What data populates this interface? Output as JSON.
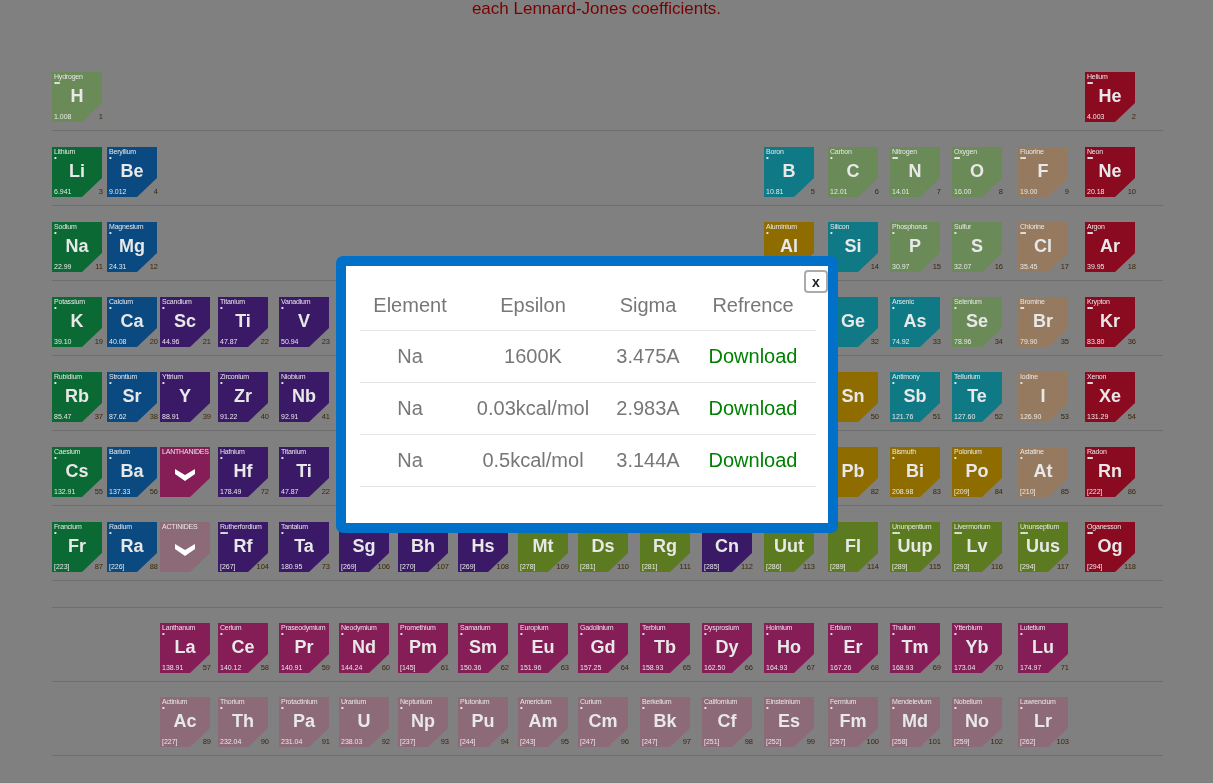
{
  "heading": "each Lennard-Jones coefficients.",
  "periodic_table": {
    "rows": [
      [
        {
          "kind": "element",
          "name": "Hydrogen",
          "dots": "•••",
          "symbol": "H",
          "mass": "1.008",
          "number": "1",
          "color": "#6a8a58"
        },
        {
          "kind": "empty"
        },
        {
          "kind": "empty"
        },
        {
          "kind": "empty"
        },
        {
          "kind": "empty"
        },
        {
          "kind": "empty"
        },
        {
          "kind": "empty"
        },
        {
          "kind": "empty"
        },
        {
          "kind": "empty"
        },
        {
          "kind": "empty"
        },
        {
          "kind": "empty"
        },
        {
          "kind": "empty"
        },
        {
          "kind": "empty"
        },
        {
          "kind": "empty"
        },
        {
          "kind": "empty"
        },
        {
          "kind": "empty"
        },
        {
          "kind": "empty"
        },
        {
          "kind": "element",
          "name": "Helium",
          "dots": "•••",
          "symbol": "He",
          "mass": "4.003",
          "number": "2",
          "color": "#8a0a20"
        }
      ],
      [
        {
          "kind": "element",
          "name": "Lithium",
          "dots": "•",
          "symbol": "Li",
          "mass": "6.941",
          "number": "3",
          "color": "#0b6a34"
        },
        {
          "kind": "element",
          "name": "Beryllium",
          "dots": "•",
          "symbol": "Be",
          "mass": "9.012",
          "number": "4",
          "color": "#0a4a80"
        },
        {
          "kind": "empty"
        },
        {
          "kind": "empty"
        },
        {
          "kind": "empty"
        },
        {
          "kind": "empty"
        },
        {
          "kind": "empty"
        },
        {
          "kind": "empty"
        },
        {
          "kind": "empty"
        },
        {
          "kind": "empty"
        },
        {
          "kind": "empty"
        },
        {
          "kind": "empty"
        },
        {
          "kind": "element",
          "name": "Boron",
          "dots": "•",
          "symbol": "B",
          "mass": "10.81",
          "number": "5",
          "color": "#0f7a85"
        },
        {
          "kind": "element",
          "name": "Carbon",
          "dots": "•",
          "symbol": "C",
          "mass": "12.01",
          "number": "6",
          "color": "#6a8a58"
        },
        {
          "kind": "element",
          "name": "Nitrogen",
          "dots": "•••",
          "symbol": "N",
          "mass": "14.01",
          "number": "7",
          "color": "#6a8a58"
        },
        {
          "kind": "element",
          "name": "Oxygen",
          "dots": "•••",
          "symbol": "O",
          "mass": "16.00",
          "number": "8",
          "color": "#6a8a58"
        },
        {
          "kind": "element",
          "name": "Fluorine",
          "dots": "•••",
          "symbol": "F",
          "mass": "19.00",
          "number": "9",
          "color": "#957a60"
        },
        {
          "kind": "element",
          "name": "Neon",
          "dots": "•••",
          "symbol": "Ne",
          "mass": "20.18",
          "number": "10",
          "color": "#8a0a20"
        }
      ],
      [
        {
          "kind": "element",
          "name": "Sodium",
          "dots": "•",
          "symbol": "Na",
          "mass": "22.99",
          "number": "11",
          "color": "#0b6a34"
        },
        {
          "kind": "element",
          "name": "Magnesium",
          "dots": "•",
          "symbol": "Mg",
          "mass": "24.31",
          "number": "12",
          "color": "#0a4a80"
        },
        {
          "kind": "empty"
        },
        {
          "kind": "empty"
        },
        {
          "kind": "empty"
        },
        {
          "kind": "empty"
        },
        {
          "kind": "empty"
        },
        {
          "kind": "empty"
        },
        {
          "kind": "empty"
        },
        {
          "kind": "empty"
        },
        {
          "kind": "empty"
        },
        {
          "kind": "empty"
        },
        {
          "kind": "element",
          "name": "Aluminium",
          "dots": "•",
          "symbol": "Al",
          "color": "#8f6c00"
        },
        {
          "kind": "element",
          "name": "Silicon",
          "dots": "•",
          "symbol": "Si",
          "number": "14",
          "color": "#0f7a85"
        },
        {
          "kind": "element",
          "name": "Phosphorus",
          "dots": "•",
          "symbol": "P",
          "mass": "30.97",
          "number": "15",
          "color": "#6a8a58"
        },
        {
          "kind": "element",
          "name": "Sulfur",
          "dots": "•",
          "symbol": "S",
          "mass": "32.07",
          "number": "16",
          "color": "#6a8a58"
        },
        {
          "kind": "element",
          "name": "Chlorine",
          "dots": "•••",
          "symbol": "Cl",
          "mass": "35.45",
          "number": "17",
          "color": "#957a60"
        },
        {
          "kind": "element",
          "name": "Argon",
          "dots": "•••",
          "symbol": "Ar",
          "mass": "39.95",
          "number": "18",
          "color": "#8a0a20"
        }
      ],
      [
        {
          "kind": "element",
          "name": "Potassium",
          "dots": "•",
          "symbol": "K",
          "mass": "39.10",
          "number": "19",
          "color": "#0b6a34"
        },
        {
          "kind": "element",
          "name": "Calcium",
          "dots": "•",
          "symbol": "Ca",
          "mass": "40.08",
          "number": "20",
          "color": "#0a4a80"
        },
        {
          "kind": "element",
          "name": "Scandium",
          "dots": "•",
          "symbol": "Sc",
          "mass": "44.96",
          "number": "21",
          "color": "#3a1a66"
        },
        {
          "kind": "element",
          "name": "Titanium",
          "dots": "•",
          "symbol": "Ti",
          "mass": "47.87",
          "number": "22",
          "color": "#3a1a66"
        },
        {
          "kind": "element",
          "name": "Vanadium",
          "dots": "•",
          "symbol": "V",
          "mass": "50.94",
          "number": "23",
          "color": "#3a1a66"
        },
        {
          "kind": "empty"
        },
        {
          "kind": "empty"
        },
        {
          "kind": "empty"
        },
        {
          "kind": "empty"
        },
        {
          "kind": "empty"
        },
        {
          "kind": "empty"
        },
        {
          "kind": "empty"
        },
        {
          "kind": "empty"
        },
        {
          "kind": "element",
          "symbol": "Ge",
          "number": "32",
          "color": "#0f7a85"
        },
        {
          "kind": "element",
          "name": "Arsenic",
          "dots": "•",
          "symbol": "As",
          "mass": "74.92",
          "number": "33",
          "color": "#0f7a85"
        },
        {
          "kind": "element",
          "name": "Selenium",
          "dots": "•",
          "symbol": "Se",
          "mass": "78.96",
          "number": "34",
          "color": "#6a8a58"
        },
        {
          "kind": "element",
          "name": "Bromine",
          "dots": "••",
          "symbol": "Br",
          "mass": "79.90",
          "number": "35",
          "color": "#957a60"
        },
        {
          "kind": "element",
          "name": "Krypton",
          "dots": "•••",
          "symbol": "Kr",
          "mass": "83.80",
          "number": "36",
          "color": "#8a0a20"
        }
      ],
      [
        {
          "kind": "element",
          "name": "Rubidium",
          "dots": "•",
          "symbol": "Rb",
          "mass": "85.47",
          "number": "37",
          "color": "#0b6a34"
        },
        {
          "kind": "element",
          "name": "Strontium",
          "dots": "•",
          "symbol": "Sr",
          "mass": "87.62",
          "number": "38",
          "color": "#0a4a80"
        },
        {
          "kind": "element",
          "name": "Yttrium",
          "dots": "•",
          "symbol": "Y",
          "mass": "88.91",
          "number": "39",
          "color": "#3a1a66"
        },
        {
          "kind": "element",
          "name": "Zirconium",
          "dots": "•",
          "symbol": "Zr",
          "mass": "91.22",
          "number": "40",
          "color": "#3a1a66"
        },
        {
          "kind": "element",
          "name": "Niobium",
          "dots": "•",
          "symbol": "Nb",
          "mass": "92.91",
          "number": "41",
          "color": "#3a1a66"
        },
        {
          "kind": "empty"
        },
        {
          "kind": "empty"
        },
        {
          "kind": "empty"
        },
        {
          "kind": "empty"
        },
        {
          "kind": "empty"
        },
        {
          "kind": "empty"
        },
        {
          "kind": "empty"
        },
        {
          "kind": "empty"
        },
        {
          "kind": "element",
          "symbol": "Sn",
          "number": "50",
          "color": "#8f6c00"
        },
        {
          "kind": "element",
          "name": "Antimony",
          "dots": "•",
          "symbol": "Sb",
          "mass": "121.76",
          "number": "51",
          "color": "#0f7a85"
        },
        {
          "kind": "element",
          "name": "Tellurium",
          "dots": "•",
          "symbol": "Te",
          "mass": "127.60",
          "number": "52",
          "color": "#0f7a85"
        },
        {
          "kind": "element",
          "name": "Iodine",
          "dots": "•",
          "symbol": "I",
          "mass": "126.90",
          "number": "53",
          "color": "#957a60"
        },
        {
          "kind": "element",
          "name": "Xenon",
          "dots": "•••",
          "symbol": "Xe",
          "mass": "131.29",
          "number": "54",
          "color": "#8a0a20"
        }
      ],
      [
        {
          "kind": "element",
          "name": "Caesium",
          "dots": "•",
          "symbol": "Cs",
          "mass": "132.91",
          "number": "55",
          "color": "#0b6a34"
        },
        {
          "kind": "element",
          "name": "Barium",
          "dots": "•",
          "symbol": "Ba",
          "mass": "137.33",
          "number": "56",
          "color": "#0a4a80"
        },
        {
          "kind": "series",
          "label": "LANTHANIDES",
          "color": "#851d57"
        },
        {
          "kind": "element",
          "name": "Hafnium",
          "dots": "•",
          "symbol": "Hf",
          "mass": "178.49",
          "number": "72",
          "color": "#3a1a66"
        },
        {
          "kind": "element",
          "name": "Titanium",
          "dots": "•",
          "symbol": "Ti",
          "mass": "47.87",
          "number": "22",
          "color": "#3a1a66"
        },
        {
          "kind": "empty"
        },
        {
          "kind": "empty"
        },
        {
          "kind": "empty"
        },
        {
          "kind": "empty"
        },
        {
          "kind": "empty"
        },
        {
          "kind": "empty"
        },
        {
          "kind": "empty"
        },
        {
          "kind": "empty"
        },
        {
          "kind": "element",
          "symbol": "Pb",
          "number": "82",
          "color": "#8f6c00"
        },
        {
          "kind": "element",
          "name": "Bismuth",
          "dots": "•",
          "symbol": "Bi",
          "mass": "208.98",
          "number": "83",
          "color": "#8f6c00"
        },
        {
          "kind": "element",
          "name": "Polonium",
          "dots": "•",
          "symbol": "Po",
          "mass": "[209]",
          "number": "84",
          "color": "#8f6c00"
        },
        {
          "kind": "element",
          "name": "Astatine",
          "dots": "•",
          "symbol": "At",
          "mass": "[210]",
          "number": "85",
          "color": "#957a60"
        },
        {
          "kind": "element",
          "name": "Radon",
          "dots": "•••",
          "symbol": "Rn",
          "mass": "[222]",
          "number": "86",
          "color": "#8a0a20"
        }
      ],
      [
        {
          "kind": "element",
          "name": "Francium",
          "dots": "•",
          "symbol": "Fr",
          "mass": "[223]",
          "number": "87",
          "color": "#0b6a34"
        },
        {
          "kind": "element",
          "name": "Radium",
          "dots": "•",
          "symbol": "Ra",
          "mass": "[226]",
          "number": "88",
          "color": "#0a4a80"
        },
        {
          "kind": "series",
          "label": "ACTINIDES",
          "color": "#8c6a78"
        },
        {
          "kind": "element",
          "name": "Rutherfordium",
          "dots": "••••",
          "symbol": "Rf",
          "mass": "[267]",
          "number": "104",
          "color": "#3a1a66"
        },
        {
          "kind": "element",
          "name": "Tantalum",
          "dots": "•",
          "symbol": "Ta",
          "mass": "180.95",
          "number": "73",
          "color": "#3a1a66"
        },
        {
          "kind": "element",
          "symbol": "Sg",
          "mass": "[269]",
          "number": "106",
          "color": "#3a1a66"
        },
        {
          "kind": "element",
          "symbol": "Bh",
          "mass": "[270]",
          "number": "107",
          "color": "#3a1a66"
        },
        {
          "kind": "element",
          "symbol": "Hs",
          "mass": "[269]",
          "number": "108",
          "color": "#3a1a66"
        },
        {
          "kind": "element",
          "symbol": "Mt",
          "mass": "[278]",
          "number": "109",
          "color": "#5c7a20"
        },
        {
          "kind": "element",
          "symbol": "Ds",
          "mass": "[281]",
          "number": "110",
          "color": "#5c7a20"
        },
        {
          "kind": "element",
          "symbol": "Rg",
          "mass": "[281]",
          "number": "111",
          "color": "#5c7a20"
        },
        {
          "kind": "element",
          "symbol": "Cn",
          "mass": "[285]",
          "number": "112",
          "color": "#3a1a66"
        },
        {
          "kind": "element",
          "symbol": "Uut",
          "mass": "[286]",
          "number": "113",
          "color": "#5c7a20"
        },
        {
          "kind": "element",
          "symbol": "Fl",
          "mass": "[289]",
          "number": "114",
          "color": "#5c7a20"
        },
        {
          "kind": "element",
          "name": "Ununpentium",
          "dots": "••••",
          "symbol": "Uup",
          "mass": "[289]",
          "number": "115",
          "color": "#5c7a20"
        },
        {
          "kind": "element",
          "name": "Livermorium",
          "dots": "••••",
          "symbol": "Lv",
          "mass": "[293]",
          "number": "116",
          "color": "#5c7a20"
        },
        {
          "kind": "element",
          "name": "Ununseptium",
          "dots": "••••",
          "symbol": "Uus",
          "mass": "[294]",
          "number": "117",
          "color": "#5c7a20"
        },
        {
          "kind": "element",
          "name": "Oganesson",
          "dots": "•••",
          "symbol": "Og",
          "mass": "[294]",
          "number": "118",
          "color": "#8a0a20"
        }
      ]
    ],
    "series_rows": [
      [
        {
          "kind": "empty"
        },
        {
          "kind": "empty"
        },
        {
          "kind": "element",
          "name": "Lanthanum",
          "dots": "•",
          "symbol": "La",
          "mass": "138.91",
          "number": "57",
          "color": "#851d57"
        },
        {
          "kind": "element",
          "name": "Cerium",
          "dots": "•",
          "symbol": "Ce",
          "mass": "140.12",
          "number": "58",
          "color": "#851d57"
        },
        {
          "kind": "element",
          "name": "Praseodymium",
          "dots": "•",
          "symbol": "Pr",
          "mass": "140.91",
          "number": "59",
          "color": "#851d57"
        },
        {
          "kind": "element",
          "name": "Neodymium",
          "dots": "•",
          "symbol": "Nd",
          "mass": "144.24",
          "number": "60",
          "color": "#851d57"
        },
        {
          "kind": "element",
          "name": "Promethium",
          "dots": "•",
          "symbol": "Pm",
          "mass": "[145]",
          "number": "61",
          "color": "#851d57"
        },
        {
          "kind": "element",
          "name": "Samarium",
          "dots": "•",
          "symbol": "Sm",
          "mass": "150.36",
          "number": "62",
          "color": "#851d57"
        },
        {
          "kind": "element",
          "name": "Europium",
          "dots": "•",
          "symbol": "Eu",
          "mass": "151.96",
          "number": "63",
          "color": "#851d57"
        },
        {
          "kind": "element",
          "name": "Gadolinium",
          "dots": "•",
          "symbol": "Gd",
          "mass": "157.25",
          "number": "64",
          "color": "#851d57"
        },
        {
          "kind": "element",
          "name": "Terbium",
          "dots": "•",
          "symbol": "Tb",
          "mass": "158.93",
          "number": "65",
          "color": "#851d57"
        },
        {
          "kind": "element",
          "name": "Dysprosium",
          "dots": "•",
          "symbol": "Dy",
          "mass": "162.50",
          "number": "66",
          "color": "#851d57"
        },
        {
          "kind": "element",
          "name": "Holmium",
          "dots": "•",
          "symbol": "Ho",
          "mass": "164.93",
          "number": "67",
          "color": "#851d57"
        },
        {
          "kind": "element",
          "name": "Erbium",
          "dots": "•",
          "symbol": "Er",
          "mass": "167.26",
          "number": "68",
          "color": "#851d57"
        },
        {
          "kind": "element",
          "name": "Thulium",
          "dots": "•",
          "symbol": "Tm",
          "mass": "168.93",
          "number": "69",
          "color": "#851d57"
        },
        {
          "kind": "element",
          "name": "Ytterbium",
          "dots": "•",
          "symbol": "Yb",
          "mass": "173.04",
          "number": "70",
          "color": "#851d57"
        },
        {
          "kind": "element",
          "name": "Lutetium",
          "dots": "•",
          "symbol": "Lu",
          "mass": "174.97",
          "number": "71",
          "color": "#851d57"
        }
      ],
      [
        {
          "kind": "empty"
        },
        {
          "kind": "empty"
        },
        {
          "kind": "element",
          "name": "Actinium",
          "dots": "•",
          "symbol": "Ac",
          "mass": "[227]",
          "number": "89",
          "color": "#8c6a78"
        },
        {
          "kind": "element",
          "name": "Thorium",
          "dots": "•",
          "symbol": "Th",
          "mass": "232.04",
          "number": "90",
          "color": "#8c6a78"
        },
        {
          "kind": "element",
          "name": "Protactinium",
          "dots": "•",
          "symbol": "Pa",
          "mass": "231.04",
          "number": "91",
          "color": "#8c6a78"
        },
        {
          "kind": "element",
          "name": "Uranium",
          "dots": "•",
          "symbol": "U",
          "mass": "238.03",
          "number": "92",
          "color": "#8c6a78"
        },
        {
          "kind": "element",
          "name": "Neptunium",
          "dots": "•",
          "symbol": "Np",
          "mass": "[237]",
          "number": "93",
          "color": "#8c6a78"
        },
        {
          "kind": "element",
          "name": "Plutonium",
          "dots": "•",
          "symbol": "Pu",
          "mass": "[244]",
          "number": "94",
          "color": "#8c6a78"
        },
        {
          "kind": "element",
          "name": "Americium",
          "dots": "•",
          "symbol": "Am",
          "mass": "[243]",
          "number": "95",
          "color": "#8c6a78"
        },
        {
          "kind": "element",
          "name": "Curium",
          "dots": "•",
          "symbol": "Cm",
          "mass": "[247]",
          "number": "96",
          "color": "#8c6a78"
        },
        {
          "kind": "element",
          "name": "Berkelium",
          "dots": "•",
          "symbol": "Bk",
          "mass": "[247]",
          "number": "97",
          "color": "#8c6a78"
        },
        {
          "kind": "element",
          "name": "Californium",
          "dots": "•",
          "symbol": "Cf",
          "mass": "[251]",
          "number": "98",
          "color": "#8c6a78"
        },
        {
          "kind": "element",
          "name": "Einsteinium",
          "dots": "•",
          "symbol": "Es",
          "mass": "[252]",
          "number": "99",
          "color": "#8c6a78"
        },
        {
          "kind": "element",
          "name": "Fermium",
          "dots": "•",
          "symbol": "Fm",
          "mass": "[257]",
          "number": "100",
          "color": "#8c6a78"
        },
        {
          "kind": "element",
          "name": "Mendelevium",
          "dots": "•",
          "symbol": "Md",
          "mass": "[258]",
          "number": "101",
          "color": "#8c6a78"
        },
        {
          "kind": "element",
          "name": "Nobelium",
          "dots": "•",
          "symbol": "No",
          "mass": "[259]",
          "number": "102",
          "color": "#8c6a78"
        },
        {
          "kind": "element",
          "name": "Lawrencium",
          "dots": "•",
          "symbol": "Lr",
          "mass": "[262]",
          "number": "103",
          "color": "#8c6a78"
        }
      ]
    ]
  },
  "dialog": {
    "close": "x",
    "columns": [
      "Element",
      "Epsilon",
      "Sigma",
      "Refrence"
    ],
    "rows": [
      {
        "element": "Na",
        "epsilon": "1600K",
        "sigma": "3.475A",
        "reference": "Download"
      },
      {
        "element": "Na",
        "epsilon": "0.03kcal/mol",
        "sigma": "2.983A",
        "reference": "Download"
      },
      {
        "element": "Na",
        "epsilon": "0.5kcal/mol",
        "sigma": "3.144A",
        "reference": "Download"
      }
    ]
  }
}
